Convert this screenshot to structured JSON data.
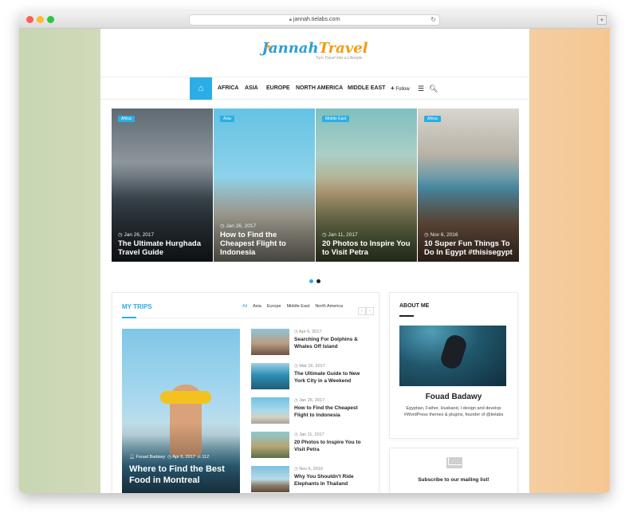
{
  "browser": {
    "url": "jannah.tielabs.com",
    "lock_icon": "lock-icon",
    "reload_icon": "reload-icon",
    "new_tab_label": "+"
  },
  "colors": {
    "accent": "#2aaee5",
    "logo_blue": "#2a9fd6",
    "logo_orange": "#f39c12"
  },
  "logo": {
    "part1": "Jannah",
    "part2": "Travel",
    "tagline": "Turn Travel Into a Lifestyle"
  },
  "nav": {
    "items": [
      "AFRICA",
      "ASIA",
      "EUROPE",
      "NORTH AMERICA",
      "MIDDLE EAST"
    ],
    "follow": "Follow"
  },
  "slider": [
    {
      "tag": "Africa",
      "date": "Jan 26, 2017",
      "title": "The Ultimate Hurghada Travel Guide"
    },
    {
      "tag": "Asia",
      "date": "Jan 26, 2017",
      "title": "How to Find the Cheapest Flight to Indonesia"
    },
    {
      "tag": "Middle East",
      "date": "Jan 11, 2017",
      "title": "20 Photos to Inspire You to Visit Petra"
    },
    {
      "tag": "Africa",
      "date": "Nov 6, 2016",
      "title": "10 Super Fun Things To Do In Egypt #thisisegypt"
    }
  ],
  "slider_pager": {
    "count": 2,
    "active": 1
  },
  "trips": {
    "heading": "MY TRIPS",
    "tabs": [
      "All",
      "Asia",
      "Europe",
      "Middle East",
      "North America"
    ],
    "active_tab": "All",
    "prev_label": "‹",
    "next_label": "›",
    "featured": {
      "author": "Fouad Badawy",
      "date": "Apr 6, 2017",
      "views": "112",
      "title": "Where to Find the Best Food in Montreal"
    },
    "posts": [
      {
        "date": "Apr 6, 2017",
        "title": "Searching For Dolphins & Whales Off Island"
      },
      {
        "date": "Mar 16, 2017",
        "title": "The Ultimate Guide to New York City in a Weekend"
      },
      {
        "date": "Jan 26, 2017",
        "title": "How to Find the Cheapest Flight to Indonesia"
      },
      {
        "date": "Jan 11, 2017",
        "title": "20 Photos to Inspire You to Visit Petra"
      },
      {
        "date": "Nov 6, 2016",
        "title": "Why You Shouldn't Ride Elephants In Thailand"
      }
    ]
  },
  "about": {
    "heading": "ABOUT ME",
    "name": "Fouad Badawy",
    "bio": "Egyptian, Father, Husband, I design and develop #WordPress themes & plugins, founder of @tielabs"
  },
  "newsletter": {
    "text": "Subscribe to our mailing list!"
  }
}
